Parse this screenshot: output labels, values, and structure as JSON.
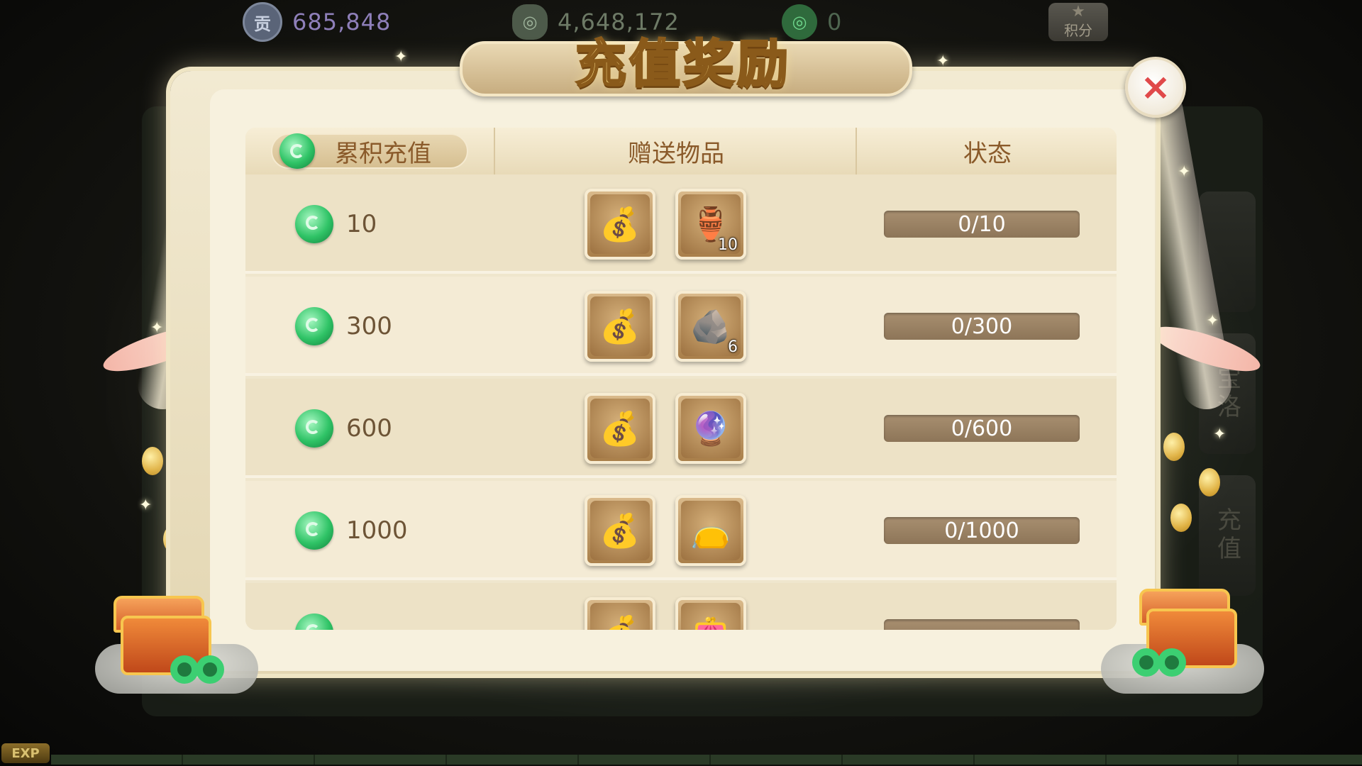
{
  "topbar": {
    "currencies": [
      {
        "icon": "contribution-icon",
        "icon_text": "贡",
        "value": "685,848"
      },
      {
        "icon": "silver-ingot-icon",
        "icon_text": "",
        "value": "4,648,172"
      },
      {
        "icon": "jade-icon",
        "icon_text": "",
        "value": "0"
      }
    ],
    "points_label": "积分"
  },
  "dialog": {
    "title": "充值奖励",
    "close_icon": "×"
  },
  "table": {
    "headers": {
      "amount": "累积充值",
      "rewards": "赠送物品",
      "status": "状态"
    },
    "rows": [
      {
        "amount": "10",
        "items": [
          {
            "icon": "silver-bag-icon",
            "glyph": "💰",
            "qty": ""
          },
          {
            "icon": "vase-plant-icon",
            "glyph": "🏺",
            "qty": "10"
          }
        ],
        "status_text": "0/10",
        "progress": 0
      },
      {
        "amount": "300",
        "items": [
          {
            "icon": "silver-bag-icon",
            "glyph": "💰",
            "qty": ""
          },
          {
            "icon": "dark-ore-icon",
            "glyph": "🪨",
            "qty": "6"
          }
        ],
        "status_text": "0/300",
        "progress": 0
      },
      {
        "amount": "600",
        "items": [
          {
            "icon": "silver-bag-icon",
            "glyph": "💰",
            "qty": ""
          },
          {
            "icon": "crystal-orb-icon",
            "glyph": "🔮",
            "qty": ""
          }
        ],
        "status_text": "0/600",
        "progress": 0
      },
      {
        "amount": "1000",
        "items": [
          {
            "icon": "silver-bag-icon",
            "glyph": "💰",
            "qty": ""
          },
          {
            "icon": "gold-lucky-bag-icon",
            "glyph": "👝",
            "qty": ""
          }
        ],
        "status_text": "0/1000",
        "progress": 0
      },
      {
        "amount": "",
        "items": [
          {
            "icon": "silver-bag-icon",
            "glyph": "💰",
            "qty": ""
          },
          {
            "icon": "red-lucky-bag-icon",
            "glyph": "👛",
            "qty": ""
          }
        ],
        "status_text": "",
        "progress": 0
      }
    ]
  },
  "background": {
    "side_tabs": [
      "",
      "宝洛",
      "充值"
    ],
    "exp_label": "EXP"
  },
  "colors": {
    "accent_gold": "#ffe08a",
    "header_brown": "#8a5a2a",
    "close_red": "#e0494a",
    "progress_bg": "#9b8264",
    "jade_green": "#2fc366"
  }
}
